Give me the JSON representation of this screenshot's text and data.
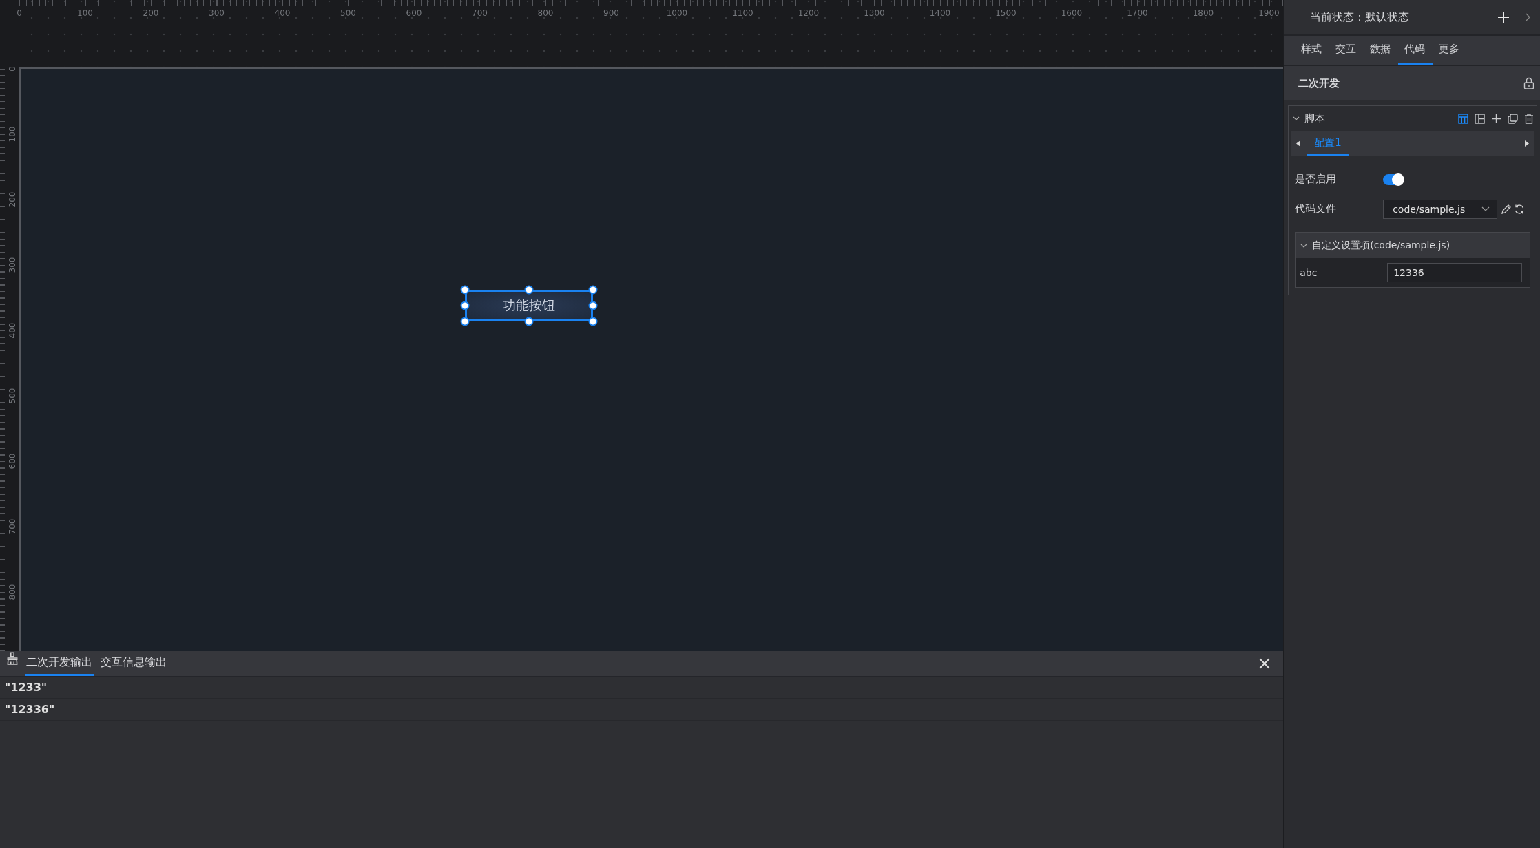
{
  "ruler": {
    "horizontal": [
      "0",
      "100",
      "200",
      "300",
      "400",
      "500",
      "600",
      "700",
      "800",
      "900",
      "1000",
      "1100",
      "1200",
      "1300",
      "1400",
      "1500",
      "1600",
      "1700",
      "1800",
      "1900"
    ],
    "vertical": [
      "0",
      "100",
      "200",
      "300",
      "400",
      "500",
      "600",
      "700",
      "800"
    ]
  },
  "canvas": {
    "widget": {
      "label": "功能按钮",
      "selected": true
    }
  },
  "output_panel": {
    "tabs": [
      {
        "label": "二次开发输出",
        "selected": true
      },
      {
        "label": "交互信息输出",
        "selected": false
      }
    ],
    "lines": [
      "\"1233\"",
      "\"12336\""
    ]
  },
  "inspector": {
    "state_label": "当前状态：默认状态",
    "tabs": [
      {
        "label": "样式",
        "selected": false
      },
      {
        "label": "交互",
        "selected": false
      },
      {
        "label": "数据",
        "selected": false
      },
      {
        "label": "代码",
        "selected": true
      },
      {
        "label": "更多",
        "selected": false
      }
    ],
    "section": {
      "title": "二次开发",
      "locked": true
    },
    "script": {
      "title": "脚本",
      "expanded": true,
      "view_modes": [
        {
          "selected": true
        },
        {
          "selected": false
        }
      ],
      "config_tabs": [
        {
          "label": "配置1",
          "selected": true
        }
      ],
      "enabled": {
        "label": "是否启用",
        "on": true
      },
      "code_file": {
        "label": "代码文件",
        "value": "code/sample.js"
      },
      "custom": {
        "title": "自定义设置项(code/sample.js)",
        "expanded": true,
        "fields": [
          {
            "label": "abc",
            "value": "12336"
          }
        ]
      }
    }
  }
}
